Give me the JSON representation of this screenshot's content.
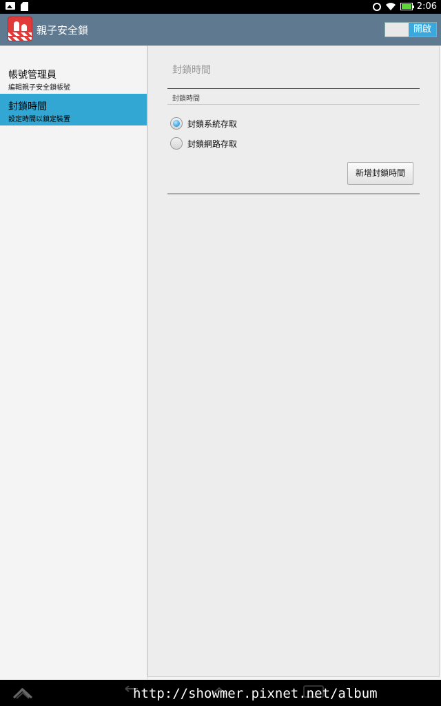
{
  "status_bar": {
    "time": "2:06",
    "icons": [
      "picture-icon",
      "sd-card-icon",
      "alarm-icon",
      "wifi-icon",
      "battery-icon"
    ],
    "battery_color": "#5fd53a"
  },
  "action_bar": {
    "title": "親子安全鎖",
    "background_color": "#5f7a90",
    "toggle_label": "開啟",
    "toggle_color": "#3aa8dc"
  },
  "sidebar": {
    "items": [
      {
        "title": "帳號管理員",
        "subtitle": "編輯親子安全鎖帳號",
        "selected": false
      },
      {
        "title": "封鎖時間",
        "subtitle": "設定時間以鎖定裝置",
        "selected": true
      }
    ],
    "selected_color": "#33a7d3"
  },
  "detail": {
    "header": "封鎖時間",
    "category": "封鎖時間",
    "options": [
      {
        "label": "封鎖系統存取",
        "checked": true
      },
      {
        "label": "封鎖網路存取",
        "checked": false
      }
    ],
    "add_button": "新增封鎖時間"
  },
  "watermark": "http://showmer.pixnet.net/album"
}
